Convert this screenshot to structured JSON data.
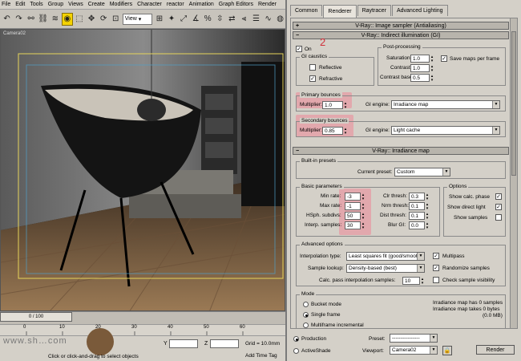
{
  "menu": [
    "File",
    "Edit",
    "Tools",
    "Group",
    "Views",
    "Create",
    "Modifiers",
    "Character",
    "reactor",
    "Animation",
    "Graph Editors",
    "Render"
  ],
  "toolbar": {
    "view_dropdown": "View"
  },
  "viewport": {
    "label": "Camera02"
  },
  "timeline": {
    "frame": "0 / 100",
    "ticks": [
      "0",
      "10",
      "20",
      "30",
      "40",
      "50",
      "60"
    ]
  },
  "status": {
    "watermark": "www.sh…com",
    "prompt": "Click or click-and-drag to select objects",
    "y_label": "Y",
    "z_label": "Z",
    "grid": "Grid = 10.0mm",
    "add_time_tag": "Add Time Tag"
  },
  "dialog": {
    "tabs": [
      "Common",
      "Renderer",
      "Raytracer",
      "Advanced Lighting"
    ],
    "active_tab": "Renderer",
    "annotation_number": "2",
    "rollouts": {
      "image_sampler": "V-Ray:: Image sampler (Antialiasing)",
      "indirect": "V-Ray:: Indirect illumination (GI)",
      "irradiance": "V-Ray:: Irradiance map"
    },
    "gi": {
      "on_label": "On",
      "on_checked": true,
      "gi_caustics": "GI caustics",
      "reflective": "Reflective",
      "reflective_checked": false,
      "refractive": "Refractive",
      "refractive_checked": true,
      "post_processing": "Post-processing",
      "saturation_label": "Saturation:",
      "saturation": "1.0",
      "contrast_label": "Contrast:",
      "contrast": "1.0",
      "contrast_base_label": "Contrast base:",
      "contrast_base": "0.5",
      "save_maps": "Save maps per frame",
      "save_maps_checked": true,
      "primary_bounces": "Primary bounces",
      "primary_multiplier_label": "Multiplier:",
      "primary_multiplier": "1.0",
      "primary_engine_label": "GI engine:",
      "primary_engine": "Irradiance map",
      "secondary_bounces": "Secondary bounces",
      "secondary_multiplier_label": "Multiplier:",
      "secondary_multiplier": "0.85",
      "secondary_engine_label": "GI engine:",
      "secondary_engine": "Light cache"
    },
    "irr": {
      "builtin_presets": "Built-in presets",
      "current_preset_label": "Current preset:",
      "current_preset": "Custom",
      "basic_params": "Basic parameters",
      "min_rate_label": "Min rate:",
      "min_rate": "-3",
      "max_rate_label": "Max rate:",
      "max_rate": "-1",
      "hsph_label": "HSph. subdivs:",
      "hsph": "50",
      "interp_label": "Interp. samples:",
      "interp": "30",
      "clr_thresh_label": "Clr thresh:",
      "clr_thresh": "0.3",
      "nrm_thresh_label": "Nrm thresh:",
      "nrm_thresh": "0.1",
      "dist_thresh_label": "Dist thresh:",
      "dist_thresh": "0.1",
      "blur_gi_label": "Blur GI:",
      "blur_gi": "0.0",
      "options": "Options",
      "show_calc": "Show calc. phase",
      "show_calc_checked": true,
      "show_direct": "Show direct light",
      "show_direct_checked": true,
      "show_samples": "Show samples",
      "show_samples_checked": false,
      "advanced": "Advanced options",
      "interp_type_label": "Interpolation type:",
      "interp_type": "Least squares fit (good/smoot",
      "multipass": "Multipass",
      "multipass_checked": true,
      "sample_lookup_label": "Sample lookup:",
      "sample_lookup": "Density-based (best)",
      "randomize": "Randomize samples",
      "randomize_checked": true,
      "calc_pass_label": "Calc. pass interpolation samples:",
      "calc_pass": "10",
      "check_vis": "Check sample visibility",
      "check_vis_checked": false,
      "mode": "Mode",
      "bucket_mode": "Bucket mode",
      "single_frame": "Single frame",
      "multiframe": "Multiframe incremental",
      "info1": "Irradiance map has 0 samples",
      "info2": "Irradiance map takes 0 bytes",
      "info3": "(0.0 MB)"
    },
    "footer": {
      "production": "Production",
      "activeshade": "ActiveShade",
      "preset_label": "Preset:",
      "preset": "----------------",
      "viewport_label": "Viewport:",
      "viewport": "Camera02",
      "render": "Render"
    }
  }
}
